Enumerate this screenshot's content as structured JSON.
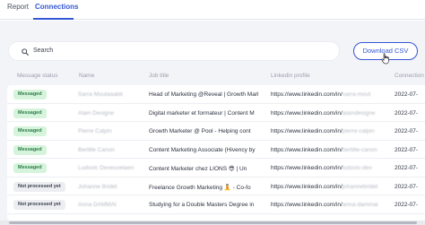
{
  "tabs": [
    {
      "label": "Report",
      "active": false
    },
    {
      "label": "Connections",
      "active": true
    }
  ],
  "search": {
    "label": "Search"
  },
  "download_button": {
    "label": "Download CSV"
  },
  "columns": [
    "Message status",
    "Name",
    "Job title",
    "Linkedin profile",
    "Connection"
  ],
  "rows": [
    {
      "status": "Messaged",
      "name": "Sarra Moutaaabit",
      "job": "Head of Marketing @Reveal | Growth Mark",
      "linkedin_prefix": "https://www.linkedin.com/in/",
      "linkedin_rest": "sarra-mout",
      "connection": "2022-07-"
    },
    {
      "status": "Messaged",
      "name": "Alain Designe",
      "job": "Digital marketer et formateur | Content M",
      "linkedin_prefix": "https://www.linkedin.com/in/",
      "linkedin_rest": "alaindesigne",
      "connection": "2022-07-"
    },
    {
      "status": "Messaged",
      "name": "Pierre Calpin",
      "job": "Growth Marketer @ Pool - Helping cont",
      "linkedin_prefix": "https://www.linkedin.com/in/",
      "linkedin_rest": "pierre-calpin",
      "connection": "2022-07-"
    },
    {
      "status": "Messaged",
      "name": "Bertille Canon",
      "job": "Content Marketing Associate (Hivency by",
      "linkedin_prefix": "https://www.linkedin.com/in/",
      "linkedin_rest": "bertille-canon",
      "connection": "2022-07-"
    },
    {
      "status": "Messaged",
      "name": "Ludovic Deveuvelaere",
      "job": "Content Marketer chez LIONS 😎 | Un",
      "linkedin_prefix": "https://www.linkedin.com/in/",
      "linkedin_rest": "ludovic-dev",
      "connection": "2022-07-"
    },
    {
      "status": "Not processed yet",
      "name": "Johanne Bridet",
      "job": "Freelance Growth Marketing 🧘 - Co-fo",
      "linkedin_prefix": "https://www.linkedin.com/in/",
      "linkedin_rest": "johannebridet",
      "connection": "2022-07-"
    },
    {
      "status": "Not processed yet",
      "name": "Anna DAMMAI",
      "job": "Studying for a Double Masters Degree in",
      "linkedin_prefix": "https://www.linkedin.com/in/",
      "linkedin_rest": "anna-dammai",
      "connection": "2022-07-"
    }
  ],
  "icons": {
    "search": "search-icon",
    "cursor": "hand-pointer-icon"
  },
  "colors": {
    "accent": "#3457d5",
    "messaged_bg": "#d6f3dc",
    "messaged_text": "#2a7d46",
    "not_processed_bg": "#eceef2",
    "panel_bg": "#f3f4f8"
  }
}
